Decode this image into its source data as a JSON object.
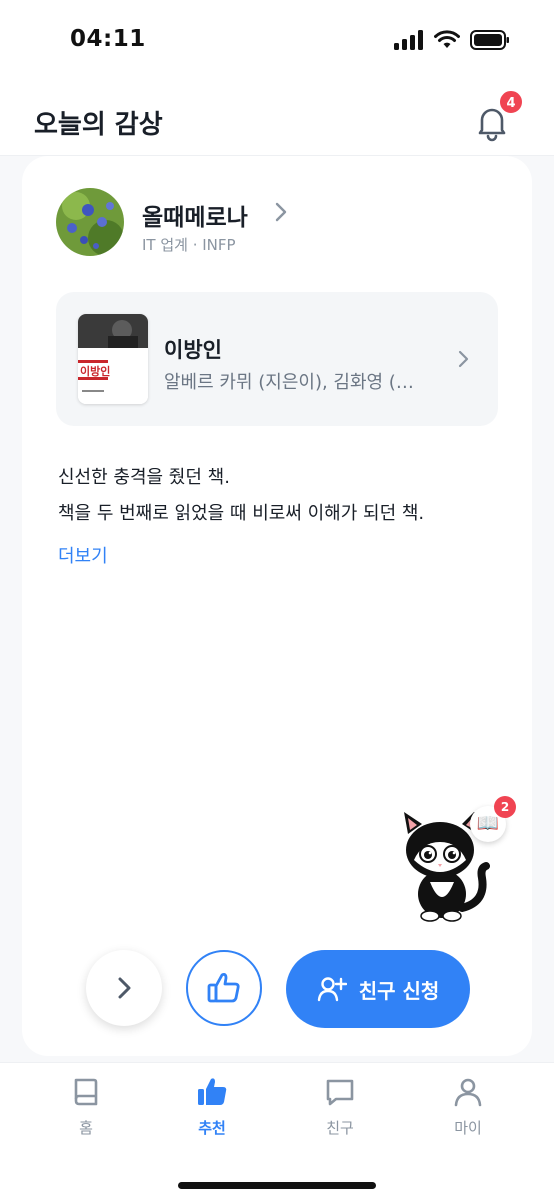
{
  "status": {
    "time": "04:11"
  },
  "header": {
    "title": "오늘의 감상",
    "notification_count": "4"
  },
  "profile": {
    "name": "올때메로나",
    "meta": "IT 업계 · INFP"
  },
  "book": {
    "title": "이방인",
    "author": "알베르 카뮈 (지은이), 김화영 (…",
    "cover_text": "이방인"
  },
  "review": {
    "line1": "신선한 충격을 줬던 책.",
    "line2": "책을 두 번째로 읽었을 때 비로써 이해가 되던 책.",
    "more_label": "더보기"
  },
  "mascot": {
    "badge_count": "2"
  },
  "actions": {
    "friend_request_label": "친구 신청"
  },
  "tabs": [
    {
      "label": "홈",
      "icon": "book-icon",
      "active": false
    },
    {
      "label": "추천",
      "icon": "thumbs-up-icon",
      "active": true
    },
    {
      "label": "친구",
      "icon": "chat-icon",
      "active": false
    },
    {
      "label": "마이",
      "icon": "person-icon",
      "active": false
    }
  ],
  "colors": {
    "accent": "#3182f6",
    "badge": "#f04452",
    "text": "#191f28",
    "muted": "#8b95a1"
  }
}
